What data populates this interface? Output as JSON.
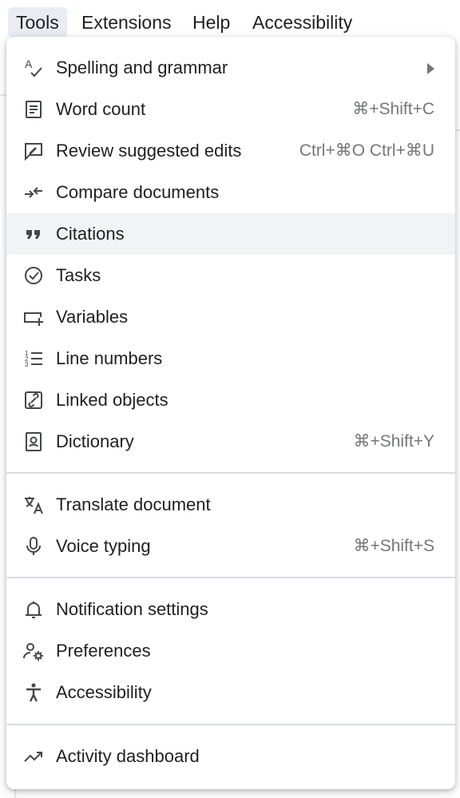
{
  "menubar": {
    "items": [
      {
        "label": "Tools",
        "active": true
      },
      {
        "label": "Extensions"
      },
      {
        "label": "Help"
      },
      {
        "label": "Accessibility"
      }
    ]
  },
  "dropdown": {
    "hovered_item": "Citations",
    "items": [
      {
        "label": "Spelling and grammar",
        "icon": "spellcheck-icon",
        "submenu": true
      },
      {
        "label": "Word count",
        "icon": "word-count-icon",
        "shortcut": "⌘+Shift+C"
      },
      {
        "label": "Review suggested edits",
        "icon": "review-edits-icon",
        "shortcut": "Ctrl+⌘O Ctrl+⌘U"
      },
      {
        "label": "Compare documents",
        "icon": "compare-icon"
      },
      {
        "label": "Citations",
        "icon": "quote-icon"
      },
      {
        "label": "Tasks",
        "icon": "task-check-icon"
      },
      {
        "label": "Variables",
        "icon": "variables-icon"
      },
      {
        "label": "Line numbers",
        "icon": "line-numbers-icon"
      },
      {
        "label": "Linked objects",
        "icon": "linked-objects-icon"
      },
      {
        "label": "Dictionary",
        "icon": "dictionary-icon",
        "shortcut": "⌘+Shift+Y"
      },
      {
        "label": "Translate document",
        "icon": "translate-icon"
      },
      {
        "label": "Voice typing",
        "icon": "microphone-icon",
        "shortcut": "⌘+Shift+S"
      },
      {
        "label": "Notification settings",
        "icon": "bell-icon"
      },
      {
        "label": "Preferences",
        "icon": "preferences-icon"
      },
      {
        "label": "Accessibility",
        "icon": "accessibility-icon"
      },
      {
        "label": "Activity dashboard",
        "icon": "trending-icon"
      }
    ]
  }
}
